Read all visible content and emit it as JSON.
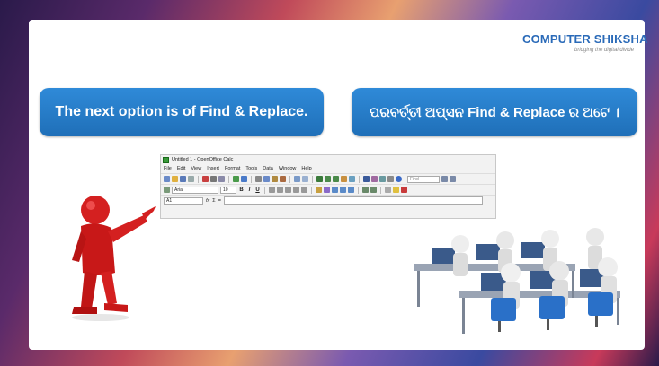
{
  "logo": {
    "name": "COMPUTER SHIKSHA",
    "tagline": "bridging the digital divide"
  },
  "captions": {
    "english": "The next option is of Find & Replace.",
    "odia": "ପରବର୍ତ୍ତୀ ଅପ୍ସନ Find & Replace ର ଅଟେ ।"
  },
  "calc_window": {
    "title": "Untitled 1 - OpenOffice Calc",
    "menu": [
      "File",
      "Edit",
      "View",
      "Insert",
      "Format",
      "Tools",
      "Data",
      "Window",
      "Help"
    ],
    "find_placeholder": "Find",
    "font_name": "Arial",
    "font_size": "10",
    "format_buttons": [
      "B",
      "I",
      "U"
    ],
    "cell_reference": "A1",
    "formula_symbols": [
      "fx",
      "Σ",
      "="
    ]
  },
  "colors": {
    "caption_blue": "#2f8ad8",
    "logo_blue": "#2a6ab8",
    "figure_red": "#d42020"
  }
}
